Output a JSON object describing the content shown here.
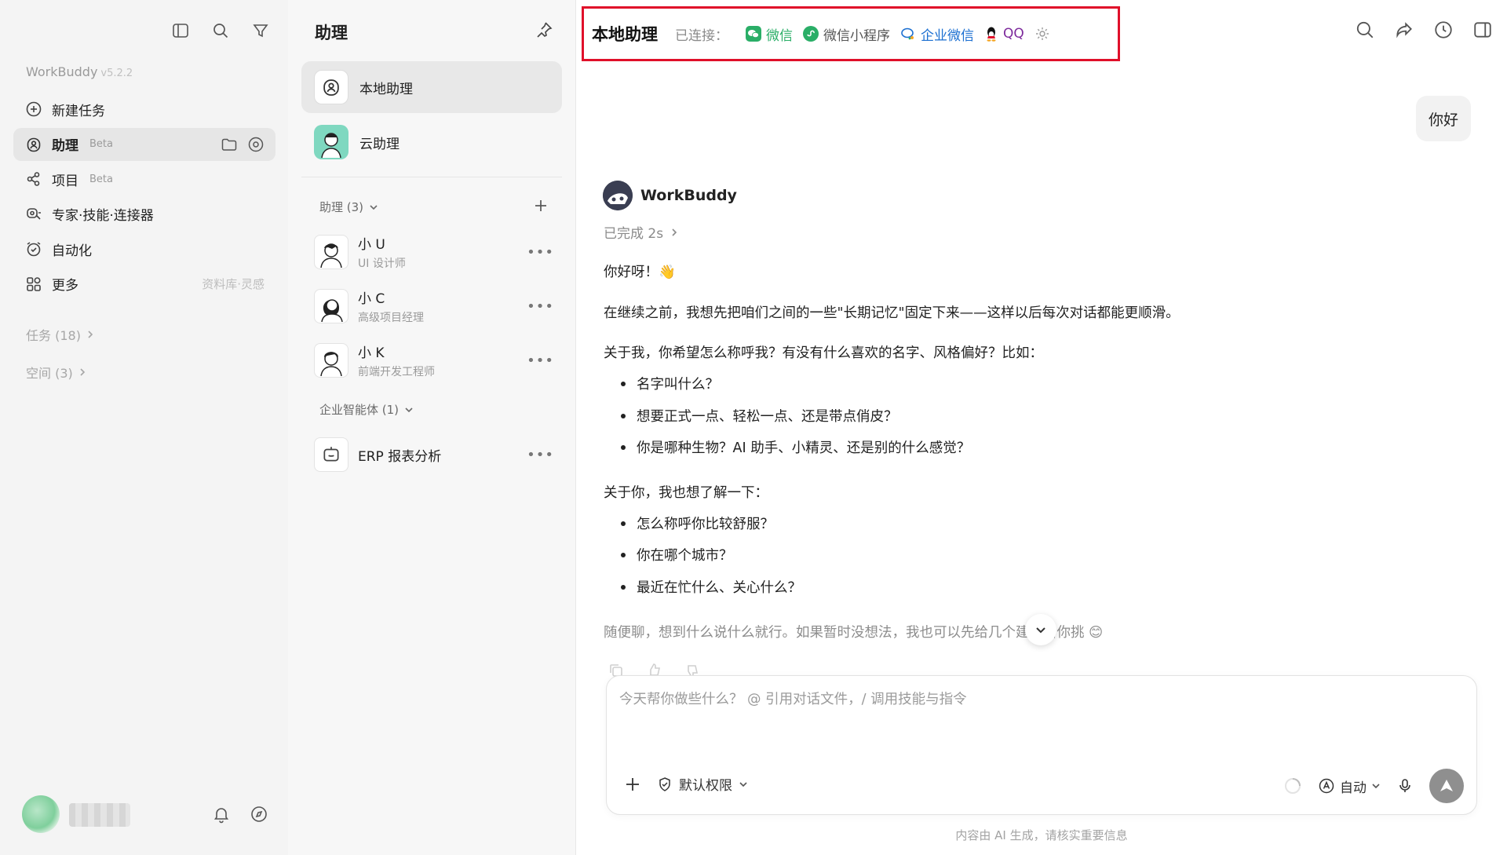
{
  "sidebar": {
    "app_name": "WorkBuddy",
    "version": "v5.2.2",
    "nav": [
      {
        "label": "新建任务",
        "icon": "plus-circle-icon"
      },
      {
        "label": "助理",
        "badge": "Beta",
        "icon": "assistant-icon"
      },
      {
        "label": "项目",
        "badge": "Beta",
        "icon": "project-icon"
      },
      {
        "label": "专家·技能·连接器",
        "icon": "experts-icon"
      },
      {
        "label": "自动化",
        "icon": "alarm-icon"
      },
      {
        "label": "更多",
        "hint": "资料库·灵感",
        "icon": "grid-icon"
      }
    ],
    "tasks": "任务 (18)",
    "spaces": "空间 (3)"
  },
  "midpanel": {
    "title": "助理",
    "items": [
      {
        "label": "本地助理"
      },
      {
        "label": "云助理"
      }
    ],
    "group_assistants": "助理 (3)",
    "agents": [
      {
        "name": "小 U",
        "role": "UI 设计师"
      },
      {
        "name": "小 C",
        "role": "高级项目经理"
      },
      {
        "name": "小 K",
        "role": "前端开发工程师"
      }
    ],
    "group_enterprise": "企业智能体 (1)",
    "enterprise_agents": [
      {
        "name": "ERP 报表分析"
      }
    ]
  },
  "topbar": {
    "title": "本地助理",
    "connected_label": "已连接：",
    "channels": [
      {
        "label": "微信",
        "color": "#2aae67"
      },
      {
        "label": "微信小程序",
        "color": "#555555"
      },
      {
        "label": "企业微信",
        "color": "#1b6fd1"
      },
      {
        "label": "QQ",
        "color": "#7d2a9c"
      }
    ]
  },
  "chat": {
    "user_message": "你好",
    "bot_name": "WorkBuddy",
    "status": "已完成 2s",
    "greeting": "你好呀！👋",
    "intro": "在继续之前，我想先把咱们之间的一些\"长期记忆\"固定下来——这样以后每次对话都能更顺滑。",
    "about_me": "关于我，你希望怎么称呼我？有没有什么喜欢的名字、风格偏好？比如：",
    "about_me_bullets": [
      "名字叫什么？",
      "想要正式一点、轻松一点、还是带点俏皮？",
      "你是哪种生物？AI 助手、小精灵、还是别的什么感觉？"
    ],
    "about_you": "关于你，我也想了解一下：",
    "about_you_bullets": [
      "怎么称呼你比较舒服？",
      "你在哪个城市？",
      "最近在忙什么、关心什么？"
    ],
    "closing": "随便聊，想到什么说什么就行。如果暂时没想法，我也可以先给几个建议给你挑 😊"
  },
  "composer": {
    "placeholder": "今天帮你做些什么？ @ 引用对话文件，/ 调用技能与指令",
    "permission": "默认权限",
    "mode": "自动"
  },
  "disclaimer": "内容由 AI 生成，请核实重要信息"
}
